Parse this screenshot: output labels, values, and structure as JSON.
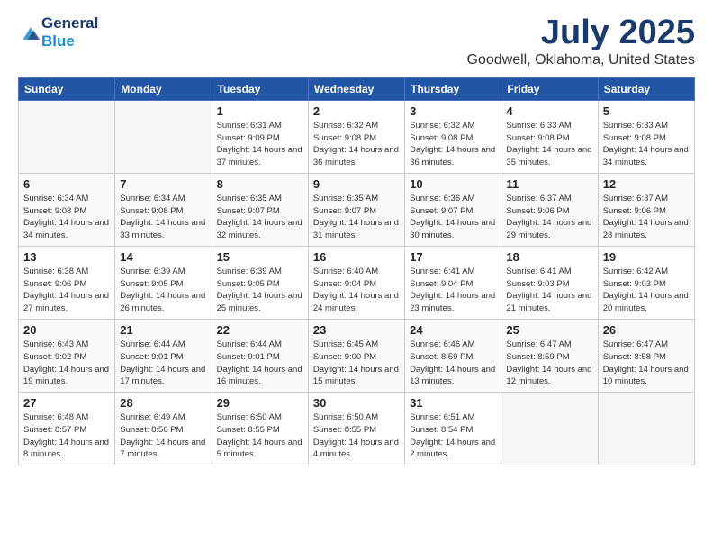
{
  "header": {
    "logo_general": "General",
    "logo_blue": "Blue",
    "month_title": "July 2025",
    "location": "Goodwell, Oklahoma, United States"
  },
  "weekdays": [
    "Sunday",
    "Monday",
    "Tuesday",
    "Wednesday",
    "Thursday",
    "Friday",
    "Saturday"
  ],
  "weeks": [
    [
      {
        "day": "",
        "empty": true
      },
      {
        "day": "",
        "empty": true
      },
      {
        "day": "1",
        "sunrise": "Sunrise: 6:31 AM",
        "sunset": "Sunset: 9:09 PM",
        "daylight": "Daylight: 14 hours and 37 minutes."
      },
      {
        "day": "2",
        "sunrise": "Sunrise: 6:32 AM",
        "sunset": "Sunset: 9:08 PM",
        "daylight": "Daylight: 14 hours and 36 minutes."
      },
      {
        "day": "3",
        "sunrise": "Sunrise: 6:32 AM",
        "sunset": "Sunset: 9:08 PM",
        "daylight": "Daylight: 14 hours and 36 minutes."
      },
      {
        "day": "4",
        "sunrise": "Sunrise: 6:33 AM",
        "sunset": "Sunset: 9:08 PM",
        "daylight": "Daylight: 14 hours and 35 minutes."
      },
      {
        "day": "5",
        "sunrise": "Sunrise: 6:33 AM",
        "sunset": "Sunset: 9:08 PM",
        "daylight": "Daylight: 14 hours and 34 minutes."
      }
    ],
    [
      {
        "day": "6",
        "sunrise": "Sunrise: 6:34 AM",
        "sunset": "Sunset: 9:08 PM",
        "daylight": "Daylight: 14 hours and 34 minutes."
      },
      {
        "day": "7",
        "sunrise": "Sunrise: 6:34 AM",
        "sunset": "Sunset: 9:08 PM",
        "daylight": "Daylight: 14 hours and 33 minutes."
      },
      {
        "day": "8",
        "sunrise": "Sunrise: 6:35 AM",
        "sunset": "Sunset: 9:07 PM",
        "daylight": "Daylight: 14 hours and 32 minutes."
      },
      {
        "day": "9",
        "sunrise": "Sunrise: 6:35 AM",
        "sunset": "Sunset: 9:07 PM",
        "daylight": "Daylight: 14 hours and 31 minutes."
      },
      {
        "day": "10",
        "sunrise": "Sunrise: 6:36 AM",
        "sunset": "Sunset: 9:07 PM",
        "daylight": "Daylight: 14 hours and 30 minutes."
      },
      {
        "day": "11",
        "sunrise": "Sunrise: 6:37 AM",
        "sunset": "Sunset: 9:06 PM",
        "daylight": "Daylight: 14 hours and 29 minutes."
      },
      {
        "day": "12",
        "sunrise": "Sunrise: 6:37 AM",
        "sunset": "Sunset: 9:06 PM",
        "daylight": "Daylight: 14 hours and 28 minutes."
      }
    ],
    [
      {
        "day": "13",
        "sunrise": "Sunrise: 6:38 AM",
        "sunset": "Sunset: 9:06 PM",
        "daylight": "Daylight: 14 hours and 27 minutes."
      },
      {
        "day": "14",
        "sunrise": "Sunrise: 6:39 AM",
        "sunset": "Sunset: 9:05 PM",
        "daylight": "Daylight: 14 hours and 26 minutes."
      },
      {
        "day": "15",
        "sunrise": "Sunrise: 6:39 AM",
        "sunset": "Sunset: 9:05 PM",
        "daylight": "Daylight: 14 hours and 25 minutes."
      },
      {
        "day": "16",
        "sunrise": "Sunrise: 6:40 AM",
        "sunset": "Sunset: 9:04 PM",
        "daylight": "Daylight: 14 hours and 24 minutes."
      },
      {
        "day": "17",
        "sunrise": "Sunrise: 6:41 AM",
        "sunset": "Sunset: 9:04 PM",
        "daylight": "Daylight: 14 hours and 23 minutes."
      },
      {
        "day": "18",
        "sunrise": "Sunrise: 6:41 AM",
        "sunset": "Sunset: 9:03 PM",
        "daylight": "Daylight: 14 hours and 21 minutes."
      },
      {
        "day": "19",
        "sunrise": "Sunrise: 6:42 AM",
        "sunset": "Sunset: 9:03 PM",
        "daylight": "Daylight: 14 hours and 20 minutes."
      }
    ],
    [
      {
        "day": "20",
        "sunrise": "Sunrise: 6:43 AM",
        "sunset": "Sunset: 9:02 PM",
        "daylight": "Daylight: 14 hours and 19 minutes."
      },
      {
        "day": "21",
        "sunrise": "Sunrise: 6:44 AM",
        "sunset": "Sunset: 9:01 PM",
        "daylight": "Daylight: 14 hours and 17 minutes."
      },
      {
        "day": "22",
        "sunrise": "Sunrise: 6:44 AM",
        "sunset": "Sunset: 9:01 PM",
        "daylight": "Daylight: 14 hours and 16 minutes."
      },
      {
        "day": "23",
        "sunrise": "Sunrise: 6:45 AM",
        "sunset": "Sunset: 9:00 PM",
        "daylight": "Daylight: 14 hours and 15 minutes."
      },
      {
        "day": "24",
        "sunrise": "Sunrise: 6:46 AM",
        "sunset": "Sunset: 8:59 PM",
        "daylight": "Daylight: 14 hours and 13 minutes."
      },
      {
        "day": "25",
        "sunrise": "Sunrise: 6:47 AM",
        "sunset": "Sunset: 8:59 PM",
        "daylight": "Daylight: 14 hours and 12 minutes."
      },
      {
        "day": "26",
        "sunrise": "Sunrise: 6:47 AM",
        "sunset": "Sunset: 8:58 PM",
        "daylight": "Daylight: 14 hours and 10 minutes."
      }
    ],
    [
      {
        "day": "27",
        "sunrise": "Sunrise: 6:48 AM",
        "sunset": "Sunset: 8:57 PM",
        "daylight": "Daylight: 14 hours and 8 minutes."
      },
      {
        "day": "28",
        "sunrise": "Sunrise: 6:49 AM",
        "sunset": "Sunset: 8:56 PM",
        "daylight": "Daylight: 14 hours and 7 minutes."
      },
      {
        "day": "29",
        "sunrise": "Sunrise: 6:50 AM",
        "sunset": "Sunset: 8:55 PM",
        "daylight": "Daylight: 14 hours and 5 minutes."
      },
      {
        "day": "30",
        "sunrise": "Sunrise: 6:50 AM",
        "sunset": "Sunset: 8:55 PM",
        "daylight": "Daylight: 14 hours and 4 minutes."
      },
      {
        "day": "31",
        "sunrise": "Sunrise: 6:51 AM",
        "sunset": "Sunset: 8:54 PM",
        "daylight": "Daylight: 14 hours and 2 minutes."
      },
      {
        "day": "",
        "empty": true
      },
      {
        "day": "",
        "empty": true
      }
    ]
  ]
}
